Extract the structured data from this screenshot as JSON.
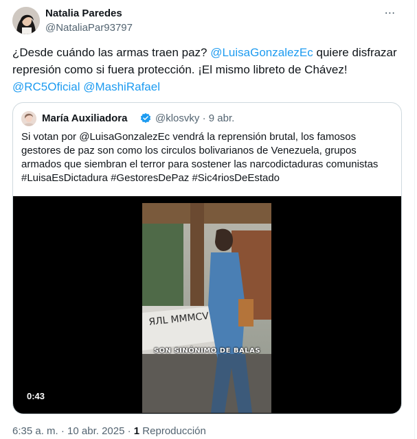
{
  "author": {
    "name": "Natalia Paredes",
    "handle": "@NataliaPar93797",
    "more_icon": "⋯"
  },
  "tweet": {
    "part1": "¿Desde cuándo las armas traen paz? ",
    "mention1": "@LuisaGonzalezEc",
    "part2": " quiere disfrazar represión como si fuera protección. ¡El mismo libreto de Chávez! ",
    "mention2": "@RC5Oficial",
    "space": " ",
    "mention3": "@MashiRafael"
  },
  "quoted": {
    "name": "María Auxiliadora",
    "handle": "@klosvky",
    "separator": "·",
    "date": "9 abr.",
    "text": "Si votan por @LuisaGonzalezEc vendrá la reprensión brutal, los famosos gestores de paz son como los circulos bolivarianos de Venezuela, grupos armados que siembran el terror para sostener las narcodictaduras comunistas #LuisaEsDictadura #GestoresDePaz #Sic4riosDeEstado",
    "video": {
      "caption": "SON SINÓNIMO DE BALAS",
      "duration": "0:43"
    }
  },
  "footer": {
    "timestamp": "6:35 a. m. · 10 abr. 2025",
    "sep": " · ",
    "views_count": "1",
    "views_label": " Reproducción"
  },
  "colors": {
    "accent": "#1d9bf0",
    "verified": "#1d9bf0"
  }
}
